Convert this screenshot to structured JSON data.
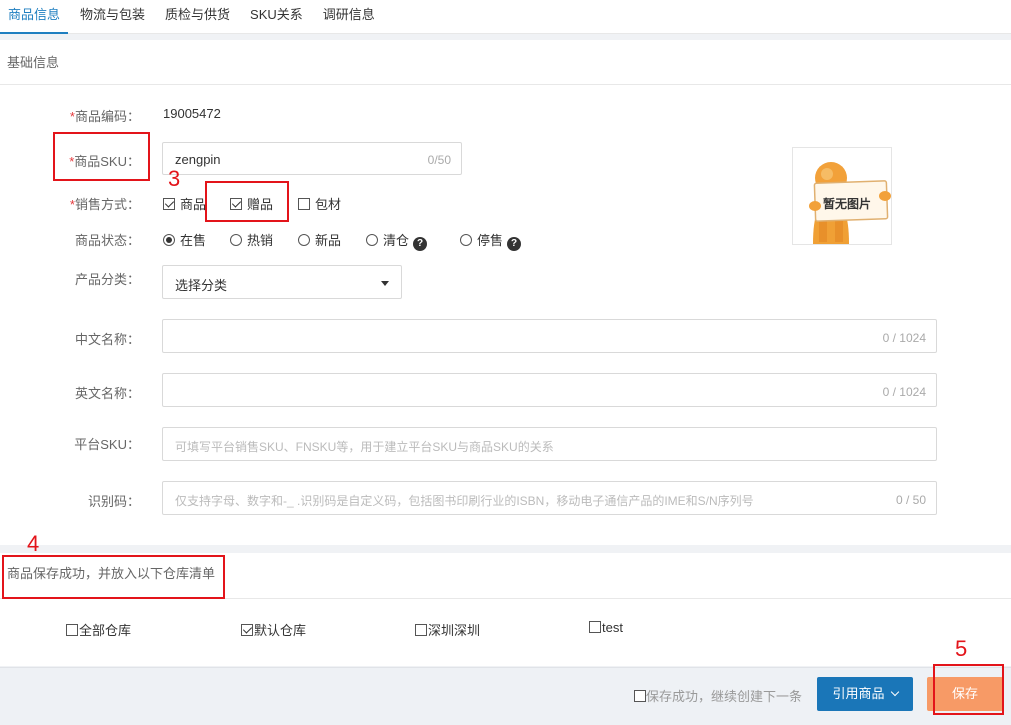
{
  "tabs": [
    {
      "label": "商品信息",
      "active": true
    },
    {
      "label": "物流与包装",
      "active": false
    },
    {
      "label": "质检与供货",
      "active": false
    },
    {
      "label": "SKU关系",
      "active": false
    },
    {
      "label": "调研信息",
      "active": false
    }
  ],
  "basic": {
    "section_title": "基础信息",
    "code_label": "商品编码：",
    "code_value": "19005472",
    "sku_label": "商品SKU：",
    "sku_value": "zengpin",
    "sku_counter": "0/50",
    "sale_label": "销售方式：",
    "sale_options": [
      {
        "label": "商品",
        "checked": true
      },
      {
        "label": "赠品",
        "checked": true
      },
      {
        "label": "包材",
        "checked": false
      }
    ],
    "status_label": "商品状态：",
    "status_options": [
      {
        "label": "在售",
        "selected": true
      },
      {
        "label": "热销",
        "selected": false
      },
      {
        "label": "新品",
        "selected": false
      },
      {
        "label": "清仓",
        "selected": false,
        "help": "?"
      },
      {
        "label": "停售",
        "selected": false,
        "help": "?"
      }
    ],
    "category_label": "产品分类：",
    "category_value": "选择分类",
    "cn_name_label": "中文名称：",
    "cn_name_counter": "0 / 1024",
    "en_name_label": "英文名称：",
    "en_name_counter": "0 / 1024",
    "platform_sku_label": "平台SKU：",
    "platform_sku_placeholder": "可填写平台销售SKU、FNSKU等，用于建立平台SKU与商品SKU的关系",
    "idcode_label": "识别码：",
    "idcode_placeholder": "仅支持字母、数字和-_ .识别码是自定义码，包括图书印刷行业的ISBN，移动电子通信产品的IME和S/N序列号",
    "idcode_counter": "0 / 50",
    "image_placeholder": "暂无图片"
  },
  "warehouse": {
    "title": "商品保存成功，并放入以下仓库清单",
    "items": [
      {
        "label": "全部仓库",
        "checked": false
      },
      {
        "label": "默认仓库",
        "checked": true
      },
      {
        "label": "深圳深圳",
        "checked": false
      },
      {
        "label": "test",
        "checked": false
      }
    ]
  },
  "footer": {
    "continue_label": "保存成功，继续创建下一条",
    "reference_label": "引用商品",
    "save_label": "保存"
  },
  "annotations": [
    "3",
    "4",
    "5"
  ],
  "colors": {
    "accent": "#1f7fc0",
    "primary_button": "#1a76b8",
    "save_button": "#f79a66",
    "annotation": "#e3141a",
    "required": "#e4393c"
  }
}
